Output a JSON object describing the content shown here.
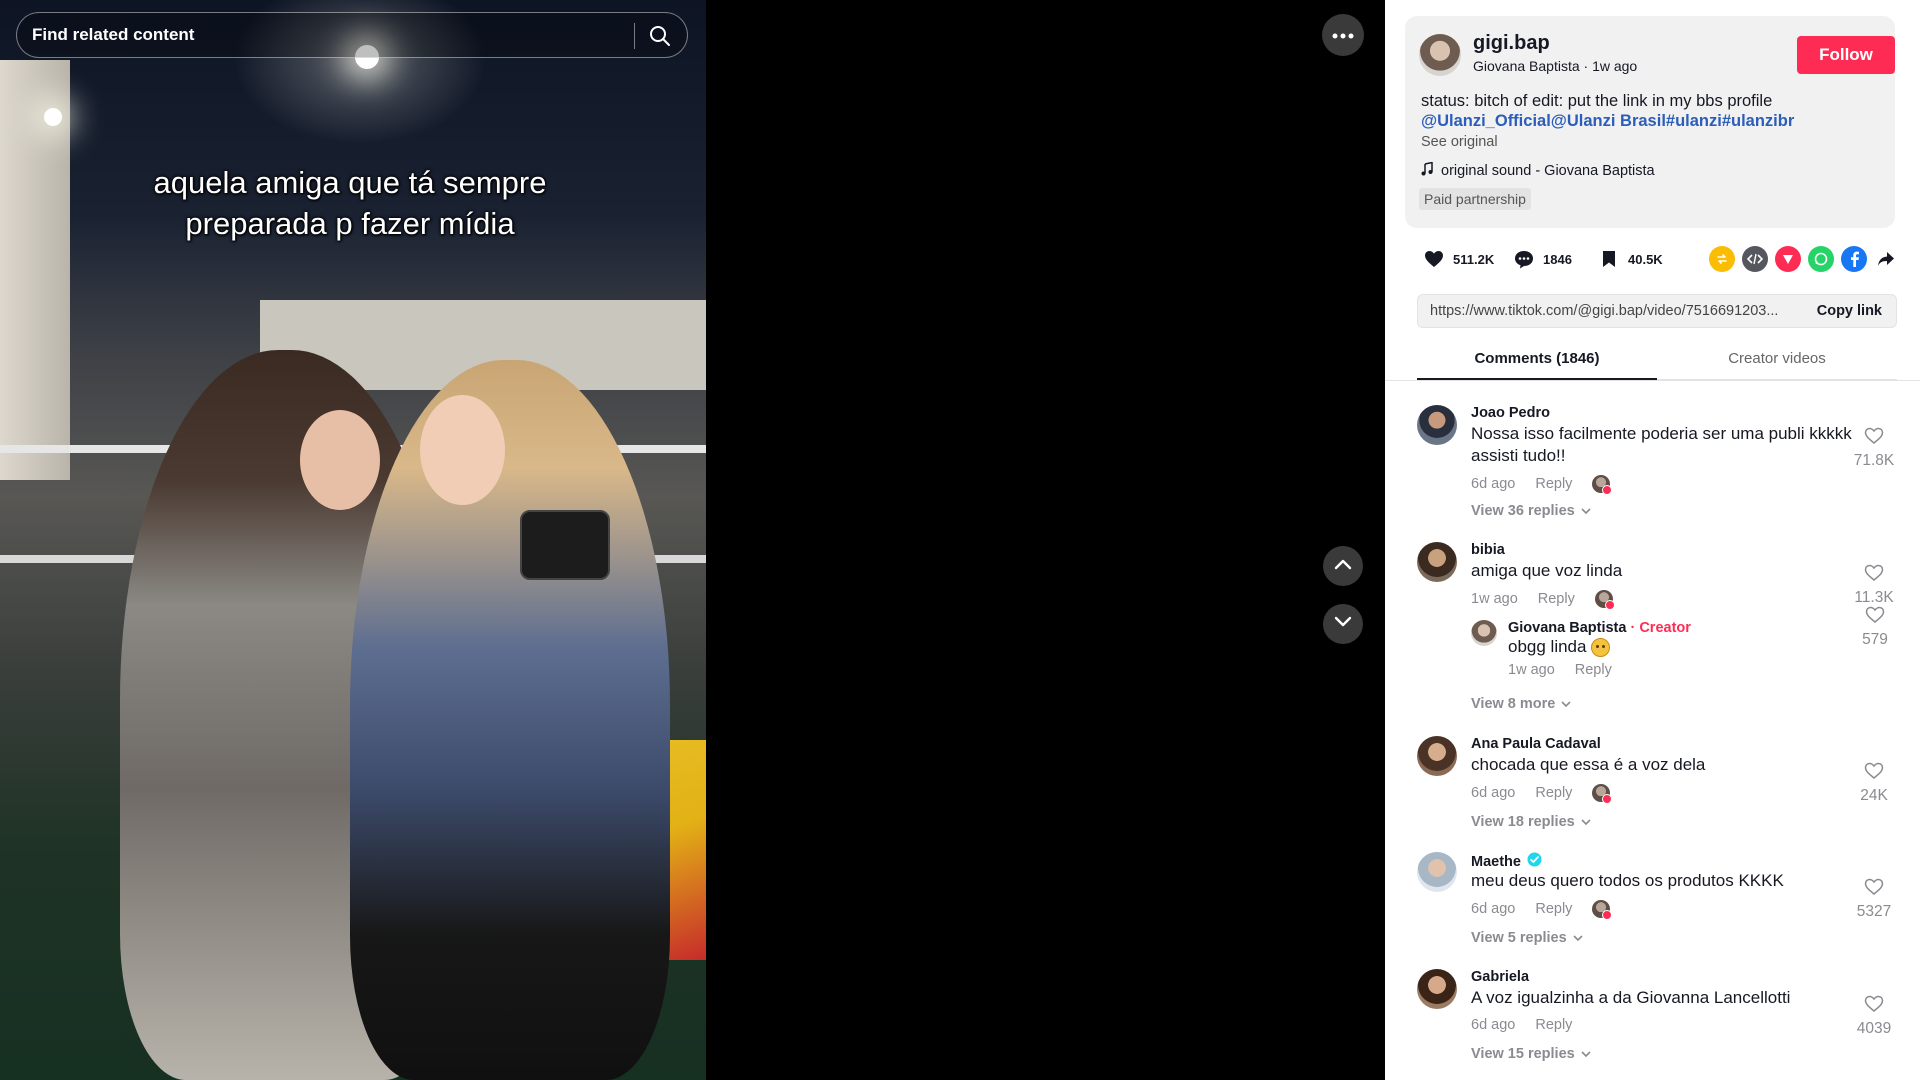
{
  "search": {
    "placeholder": "Find related content"
  },
  "video": {
    "caption_line1": "aquela amiga que tá sempre",
    "caption_line2": "preparada p fazer mídia"
  },
  "post": {
    "username": "gigi.bap",
    "display_name": "Giovana Baptista",
    "posted": "1w ago",
    "follow_label": "Follow",
    "description": "status: bitch of edit: put the link in my bbs profile",
    "tags": "@Ulanzi_Official@Ulanzi Brasil#ulanzi#ulanzibr",
    "see_original": "See original",
    "sound": "original sound - Giovana Baptista",
    "paid_label": "Paid partnership"
  },
  "stats": {
    "likes": "511.2K",
    "comments": "1846",
    "saves": "40.5K"
  },
  "share_icons": [
    "repost-icon",
    "embed-icon",
    "send-icon",
    "whatsapp-icon",
    "facebook-icon",
    "share-arrow-icon"
  ],
  "link": {
    "url": "https://www.tiktok.com/@gigi.bap/video/7516691203...",
    "copy_label": "Copy link"
  },
  "tabs": {
    "comments": "Comments (1846)",
    "creator": "Creator videos"
  },
  "comments": [
    {
      "user": "Joao Pedro",
      "text": "Nossa isso facilmente poderia ser uma publi kkkkk assisti tudo!!",
      "time": "6d ago",
      "reply": "Reply",
      "likes": "71.8K",
      "view_replies": "View 36 replies"
    },
    {
      "user": "bibia",
      "text": "amiga que voz linda",
      "time": "1w ago",
      "reply": "Reply",
      "likes": "11.3K",
      "view_replies": "View 8 more",
      "creator_reply": {
        "user": "Giovana Baptista",
        "tag": " · Creator",
        "text": "obgg linda",
        "time": "1w ago",
        "reply": "Reply",
        "likes": "579"
      }
    },
    {
      "user": "Ana Paula Cadaval",
      "text": "chocada que essa é a voz dela",
      "time": "6d ago",
      "reply": "Reply",
      "likes": "24K",
      "view_replies": "View 18 replies"
    },
    {
      "user": "Maethe",
      "text": "meu deus quero todos os produtos KKKK",
      "time": "6d ago",
      "reply": "Reply",
      "likes": "5327",
      "view_replies": "View 5 replies"
    },
    {
      "user": "Gabriela",
      "text": "A voz igualzinha a da Giovanna Lancellotti",
      "time": "6d ago",
      "reply": "Reply",
      "likes": "4039",
      "view_replies": "View 15 replies"
    }
  ],
  "colors": {
    "accent": "#fe2c55",
    "link": "#2b5db9",
    "verified": "#20d5ec"
  }
}
